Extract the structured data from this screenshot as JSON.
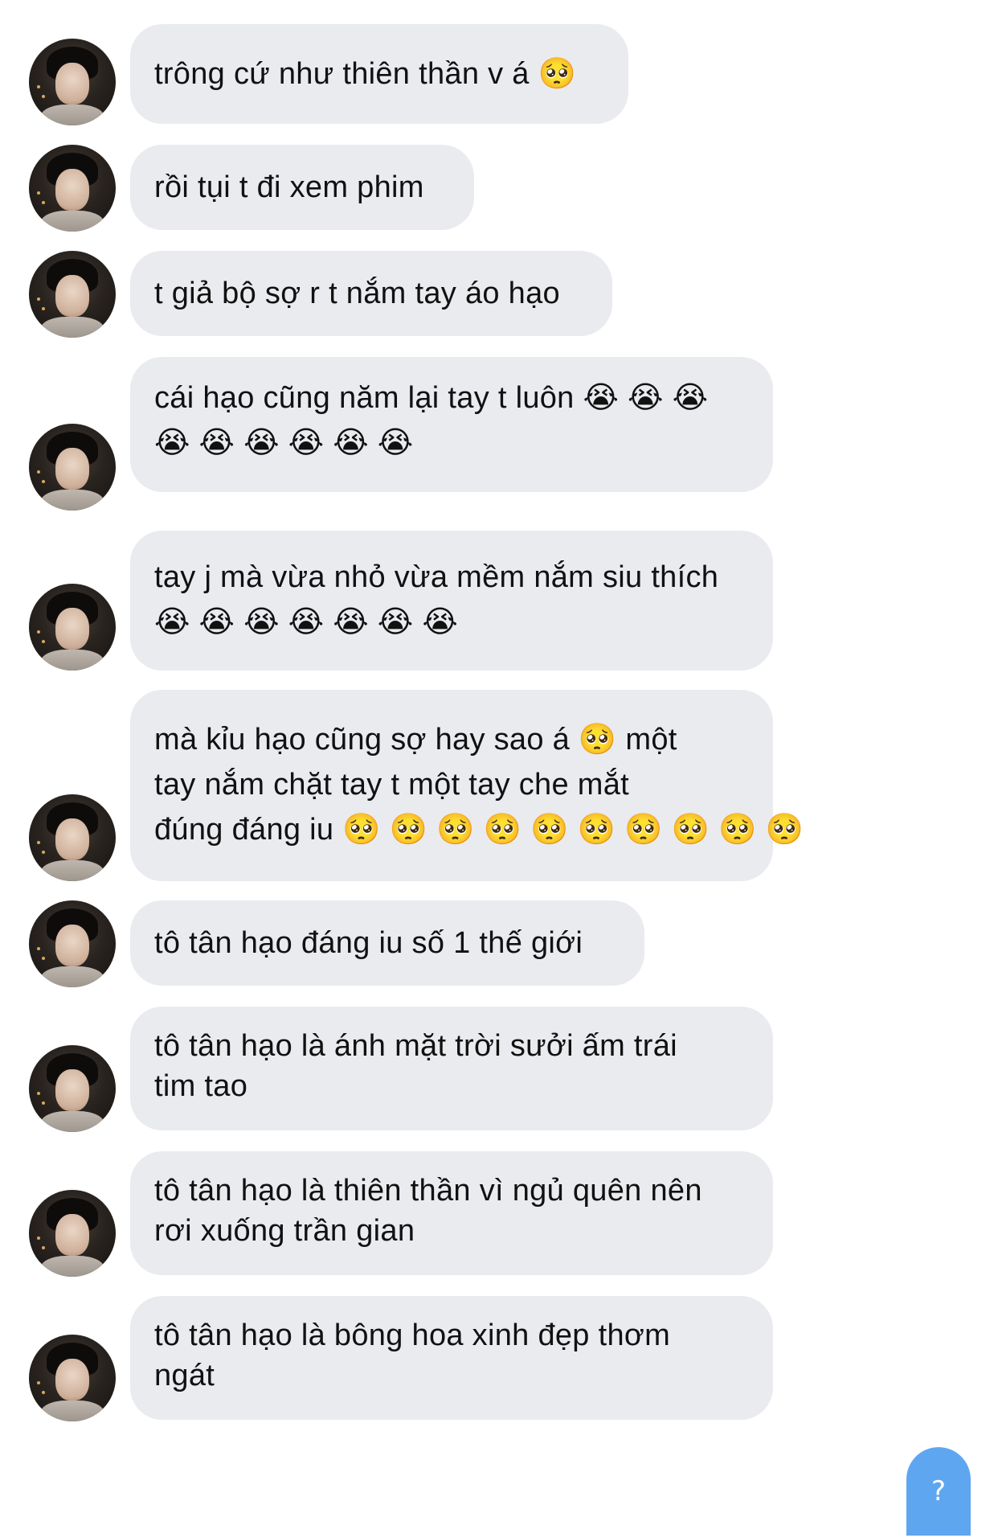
{
  "messages": [
    {
      "id": "m1",
      "lines": [
        "trông cứ như thiên thần v á 🥺"
      ]
    },
    {
      "id": "m2",
      "lines": [
        "rồi tụi t đi xem phim"
      ]
    },
    {
      "id": "m3",
      "lines": [
        "t giả bộ sợ r t nắm tay áo hạo"
      ]
    },
    {
      "id": "m4",
      "lines": [
        "cái hạo cũng năm lại tay t luôn 😭 😭 😭",
        "😭 😭 😭 😭 😭 😭"
      ]
    },
    {
      "id": "m5",
      "lines": [
        "tay j mà vừa nhỏ vừa mềm nắm siu thích",
        "😭 😭 😭 😭 😭 😭 😭"
      ]
    },
    {
      "id": "m6",
      "lines": [
        "mà kỉu hạo cũng sợ hay sao á 🥺  một",
        "tay nắm chặt tay t một tay che mắt",
        "đúng đáng iu 🥺 🥺 🥺 🥺 🥺 🥺 🥺 🥺 🥺 🥺"
      ]
    },
    {
      "id": "m7",
      "lines": [
        "tô tân hạo đáng iu số 1 thế giới"
      ]
    },
    {
      "id": "m8",
      "lines": [
        "tô tân hạo là ánh mặt trời sưởi ấm trái",
        "tim tao"
      ]
    },
    {
      "id": "m9",
      "lines": [
        "tô tân hạo là thiên thần vì ngủ quên nên",
        "rơi xuống trần gian"
      ]
    },
    {
      "id": "m10",
      "lines": [
        "tô tân hạo là bông hoa xinh đẹp thơm",
        "ngát"
      ]
    }
  ],
  "help_button": {
    "label": "?"
  },
  "colors": {
    "bubble_bg": "#e9ebef",
    "text": "#111111",
    "help_button_bg": "#5ea6f0"
  }
}
